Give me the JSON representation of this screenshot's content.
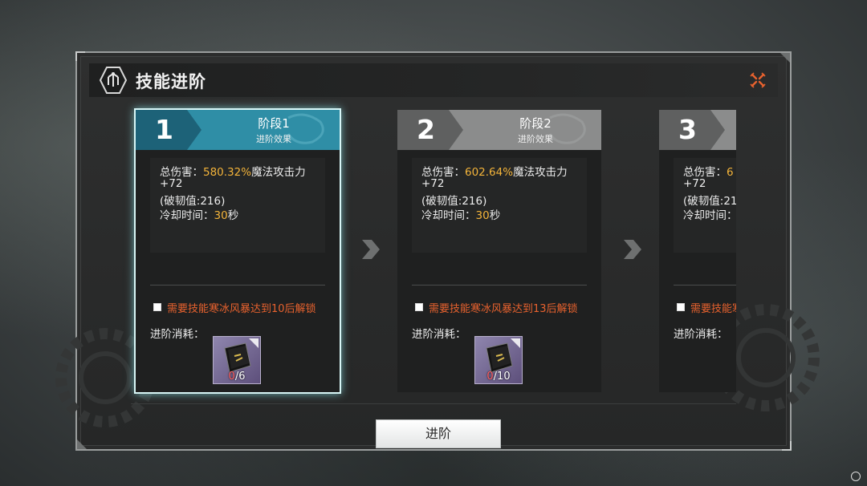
{
  "dialog": {
    "title": "技能进阶",
    "icons": {
      "emblem": "skill-emblem-icon",
      "close": "close-icon"
    },
    "accent": "#e8622e"
  },
  "stages": [
    {
      "number": "1",
      "title": "阶段1",
      "subtitle": "进阶效果",
      "active": true,
      "header_color": "#1f6f84",
      "effects": {
        "damage_label": "总伤害：",
        "damage_value": "580.32%",
        "damage_suffix": "魔法攻击力",
        "bonus": "+72",
        "break_value": "(破韧值:216)",
        "cooldown_label": "冷却时间：",
        "cooldown_value": "30",
        "cooldown_unit": "秒"
      },
      "requirement": "需要技能寒冰风暴达到10后解锁",
      "cost_label": "进阶消耗：",
      "cost_item": {
        "icon": "skill-book-icon",
        "owned": "0",
        "needed": "/6"
      }
    },
    {
      "number": "2",
      "title": "阶段2",
      "subtitle": "进阶效果",
      "active": false,
      "header_color": "#6a6b6b",
      "effects": {
        "damage_label": "总伤害：",
        "damage_value": "602.64%",
        "damage_suffix": "魔法攻击力",
        "bonus": "+72",
        "break_value": "(破韧值:216)",
        "cooldown_label": "冷却时间：",
        "cooldown_value": "30",
        "cooldown_unit": "秒"
      },
      "requirement": "需要技能寒冰风暴达到13后解锁",
      "cost_label": "进阶消耗：",
      "cost_item": {
        "icon": "skill-book-icon",
        "owned": "0",
        "needed": "/10"
      }
    },
    {
      "number": "3",
      "title": "",
      "subtitle": "",
      "active": false,
      "header_color": "#6a6b6b",
      "effects": {
        "damage_label": "总伤害：",
        "damage_value": "6",
        "damage_suffix": "",
        "bonus": "+72",
        "break_value": "(破韧值:21",
        "cooldown_label": "冷却时间：",
        "cooldown_value": "",
        "cooldown_unit": ""
      },
      "requirement": "需要技能寒",
      "cost_label": "进阶消耗："
    }
  ],
  "footer": {
    "advance_button": "进阶"
  }
}
